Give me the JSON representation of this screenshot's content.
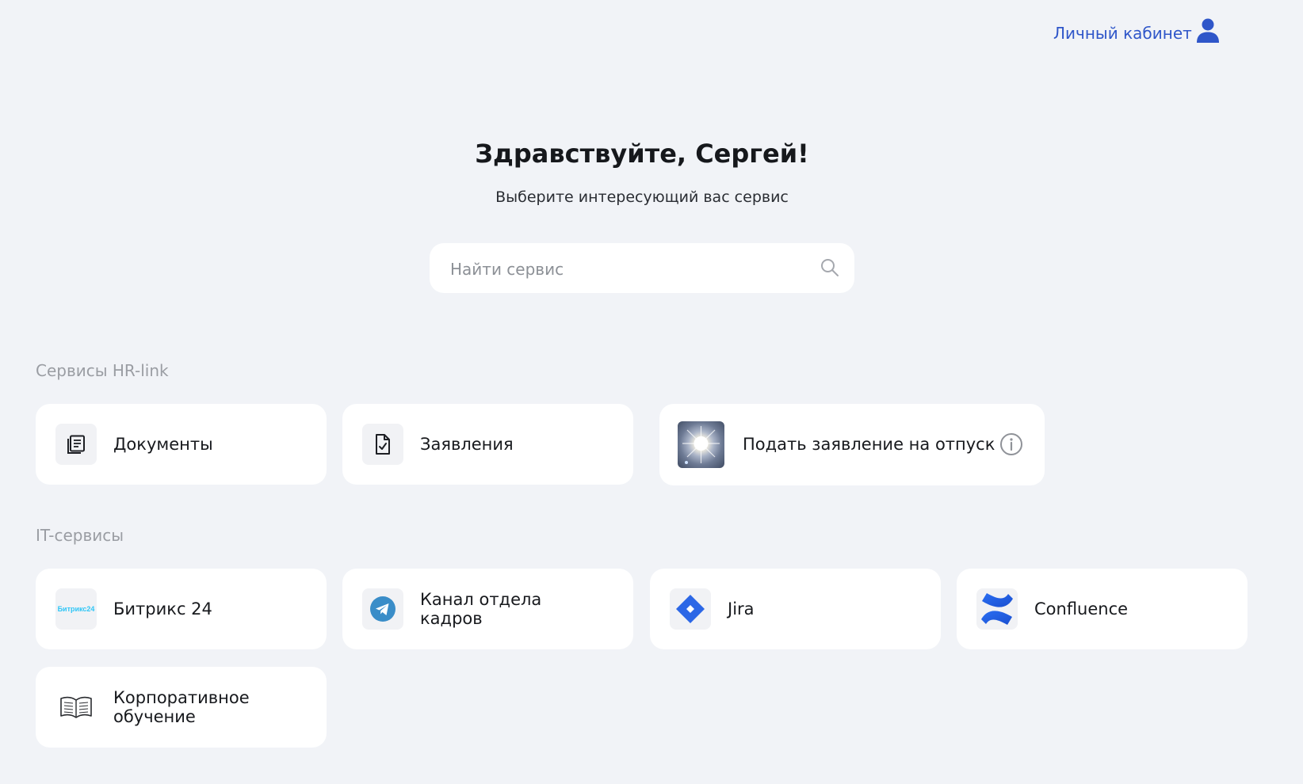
{
  "header": {
    "account_label": "Личный кабинет",
    "account_icon": "user-icon"
  },
  "hero": {
    "title": "Здравствуйте, Сергей!",
    "subtitle": "Выберите интересующий вас сервис"
  },
  "search": {
    "placeholder": "Найти сервис",
    "value": "",
    "icon": "search-icon"
  },
  "sections": [
    {
      "title": "Сервисы HR-link",
      "cards": [
        {
          "label": "Документы",
          "icon": "documents-icon"
        },
        {
          "label": "Заявления",
          "icon": "file-check-icon"
        },
        {
          "label": "Подать заявление на отпуск",
          "icon": "vacation-photo",
          "info_icon": "info-icon"
        }
      ]
    },
    {
      "title": "IT-сервисы",
      "cards": [
        {
          "label": "Битрикс 24",
          "icon": "bitrix24-logo",
          "logo_text": "Битрикс24"
        },
        {
          "label": "Канал отдела кадров",
          "icon": "telegram-icon"
        },
        {
          "label": "Jira",
          "icon": "jira-icon"
        },
        {
          "label": "Confluence",
          "icon": "confluence-icon"
        },
        {
          "label": "Корпоративное обучение",
          "icon": "book-icon"
        }
      ]
    }
  ],
  "colors": {
    "background": "#f1f3f7",
    "card": "#ffffff",
    "accent": "#2f56c9",
    "muted": "#9a9da3"
  }
}
